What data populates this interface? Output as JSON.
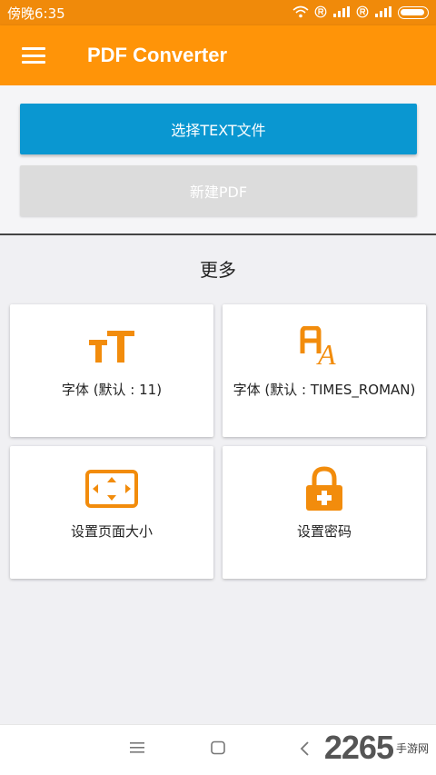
{
  "status_bar": {
    "time": "傍晚6:35"
  },
  "app_bar": {
    "title": "PDF Converter"
  },
  "buttons": {
    "select_text": "选择TEXT文件",
    "new_pdf": "新建PDF"
  },
  "section": {
    "title": "更多"
  },
  "cards": [
    {
      "label": "字体 (默认 : 11)",
      "icon": "font-size-icon"
    },
    {
      "label": "字体 (默认 : TIMES_ROMAN)",
      "icon": "font-family-icon"
    },
    {
      "label": "设置页面大小",
      "icon": "page-size-icon"
    },
    {
      "label": "设置密码",
      "icon": "lock-plus-icon"
    }
  ],
  "watermark": {
    "number": "2265",
    "text": "手游网"
  },
  "colors": {
    "accent": "#ff9408",
    "primary_button": "#0a97d1",
    "icon_orange": "#f28c0c"
  }
}
